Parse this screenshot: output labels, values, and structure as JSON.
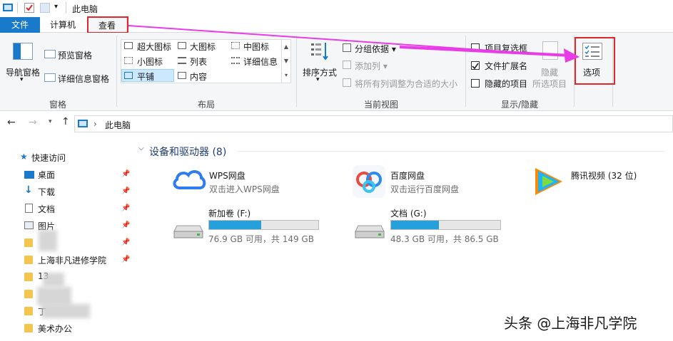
{
  "window": {
    "title": "此电脑"
  },
  "tabs": {
    "file": "文件",
    "computer": "计算机",
    "view": "查看"
  },
  "ribbon": {
    "panes": {
      "nav_pane": "导航窗格",
      "preview": "预览窗格",
      "details": "详细信息窗格",
      "label": "窗格"
    },
    "layout": {
      "items": [
        "超大图标",
        "大图标",
        "中图标",
        "小图标",
        "列表",
        "详细信息",
        "平铺",
        "内容"
      ],
      "label": "布局"
    },
    "current_view": {
      "sort": "排序方式",
      "group": "分组依据",
      "add_col": "添加列",
      "fit_cols": "将所有列调整为合适的大小",
      "label": "当前视图"
    },
    "show_hide": {
      "item_checkbox": "项目复选框",
      "extensions": "文件扩展名",
      "hidden": "隐藏的项目",
      "hide_selected_1": "隐藏",
      "hide_selected_2": "所选项目",
      "label": "显示/隐藏"
    },
    "options": {
      "label": "选项"
    }
  },
  "address": {
    "path": "此电脑"
  },
  "nav": {
    "quick_access": "快速访问",
    "items": [
      "桌面",
      "下载",
      "文档",
      "图片",
      "",
      "上海非凡进修学院",
      "13",
      "",
      "丁",
      "美术办公"
    ]
  },
  "content": {
    "group_title": "设备和驱动器 (8)",
    "apps": [
      {
        "name": "WPS网盘",
        "desc": "双击进入WPS网盘"
      },
      {
        "name": "百度网盘",
        "desc": "双击运行百度网盘"
      },
      {
        "name": "腾讯视频 (32 位)",
        "desc": ""
      }
    ],
    "drives": [
      {
        "name": "新加卷 (F:)",
        "usage": "76.9 GB 可用，共 149 GB",
        "used_fraction": 0.48
      },
      {
        "name": "文档 (G:)",
        "usage": "48.3 GB 可用，共 86.5 GB",
        "used_fraction": 0.44
      }
    ]
  },
  "watermark": "头条 @上海非凡学院",
  "colors": {
    "accent": "#1979ca",
    "annotation_red": "#e0282c",
    "arrow_magenta": "#e83de6",
    "bar_fill": "#26a0da"
  }
}
